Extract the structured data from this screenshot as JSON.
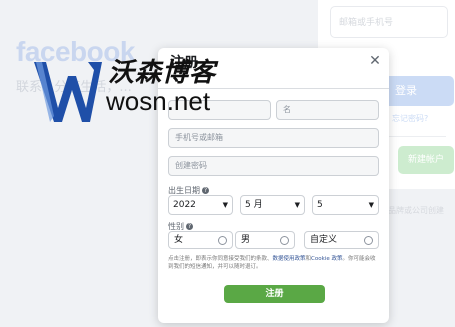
{
  "background": {
    "logo": "facebook",
    "tagline": "联系...分享生活，...",
    "login": {
      "contact_placeholder": "邮箱或手机号",
      "login_button": "登录",
      "forgot_link": "忘记密码?",
      "create_button": "新建帐户",
      "footer_text": "品牌或公司创建"
    }
  },
  "modal": {
    "title": "注册",
    "subtitle": "",
    "close_icon": "close-icon",
    "last_name_placeholder": "",
    "first_name_placeholder": "名",
    "contact_placeholder": "手机号或邮箱",
    "password_placeholder": "创建密码",
    "dob_label": "出生日期",
    "dob": {
      "year": "2022",
      "month": "5 月",
      "day": "5"
    },
    "gender_label": "性别",
    "gender_options": [
      "女",
      "男",
      "自定义"
    ],
    "terms_before": "点击注册，即表示你同意接受我们的条款、",
    "terms_link_1": "数据使用政策",
    "terms_and": "和",
    "terms_link_2": "Cookie 政策",
    "terms_after": "。你可能会收到我们的短信通知，并可以随时退订。",
    "signup_button": "注册",
    "signup_color": "#5aa845"
  },
  "watermark": {
    "name": "沃森博客",
    "url": "wosn.net",
    "color": "#1f4fa8"
  }
}
